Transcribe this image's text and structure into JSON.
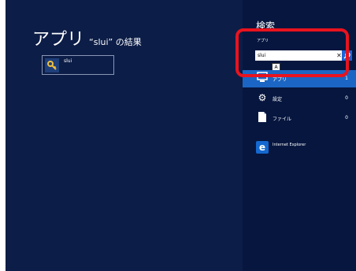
{
  "results_page": {
    "title": "アプリ",
    "subtitle": "“slui” の結果",
    "result": {
      "label": "slui",
      "icon": "key-icon"
    }
  },
  "search_pane": {
    "title": "検索",
    "scope": "アプリ",
    "query": "slui",
    "clear_icon": "✕",
    "search_icon": "⚲",
    "ime_indicator": "A",
    "categories": [
      {
        "label": "アプリ",
        "count": "1",
        "icon": "apps-icon",
        "selected": true
      },
      {
        "label": "設定",
        "count": "0",
        "icon": "gear-icon"
      },
      {
        "label": "ファイル",
        "count": "0",
        "icon": "file-icon"
      }
    ],
    "apps": [
      {
        "label": "Internet Explorer",
        "icon": "ie-icon"
      }
    ]
  },
  "colors": {
    "background": "#0c1d47",
    "pane": "#06163f",
    "selection": "#1b66c4",
    "highlight": "#e8131e"
  }
}
